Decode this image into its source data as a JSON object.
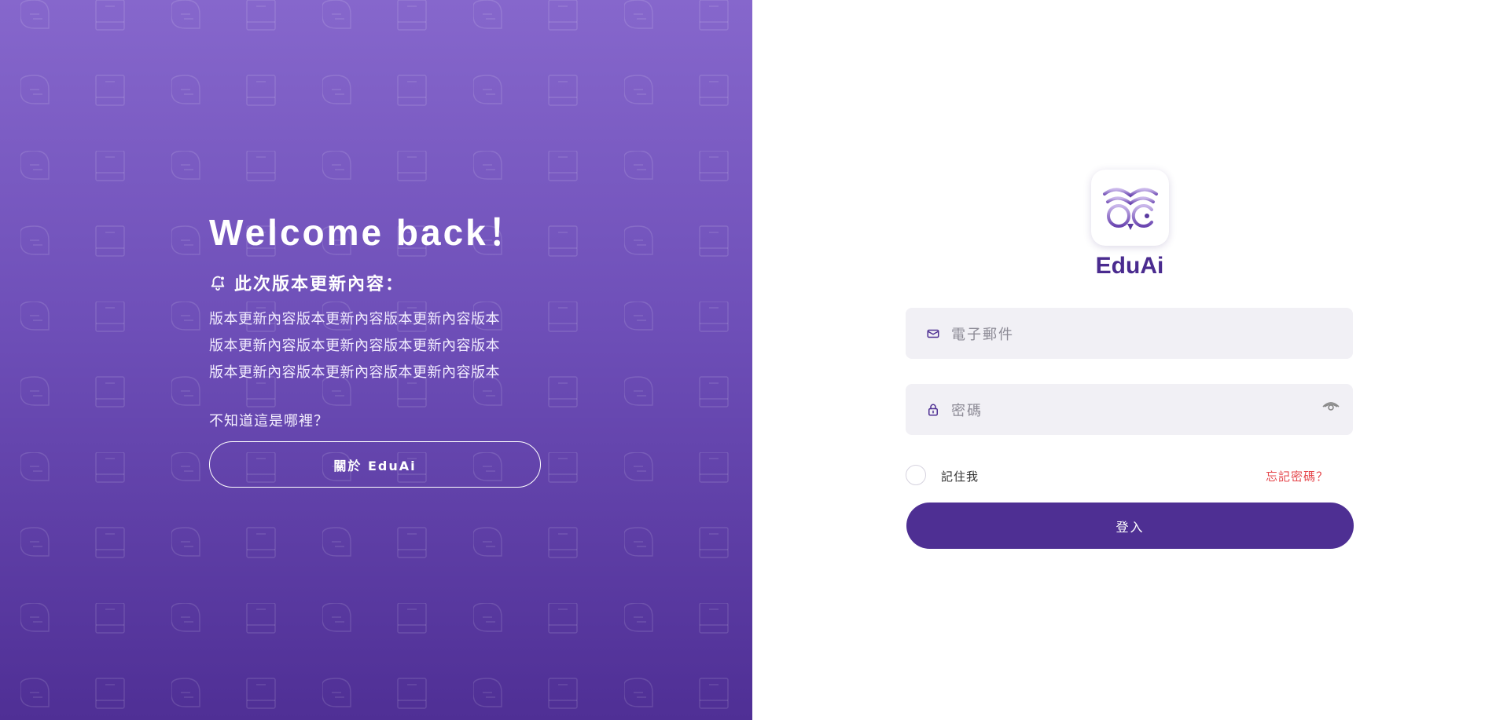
{
  "hero": {
    "title": "Welcome back！",
    "update_heading": "此次版本更新內容：",
    "update_lines": [
      "版本更新內容版本更新內容版本更新內容版本",
      "版本更新內容版本更新內容版本更新內容版本",
      "版本更新內容版本更新內容版本更新內容版本"
    ],
    "unknown_text": "不知道這是哪裡？",
    "about_button": "關於 EduAi"
  },
  "brand": {
    "name": "EduAi"
  },
  "form": {
    "email_placeholder": "電子郵件",
    "password_placeholder": "密碼",
    "remember_label": "記住我",
    "forgot_link": "忘記密碼？",
    "login_button": "登入"
  },
  "icons": {
    "bell": "bell-icon",
    "mail": "mail-icon",
    "lock": "lock-icon",
    "eye": "eye-icon",
    "logo": "owl-logo"
  },
  "colors": {
    "primary": "#4e2f93",
    "gradient_top": "#8667cc",
    "gradient_bottom": "#4f2f95",
    "field_bg": "#f1f0f5",
    "link_red": "#e5484d"
  }
}
